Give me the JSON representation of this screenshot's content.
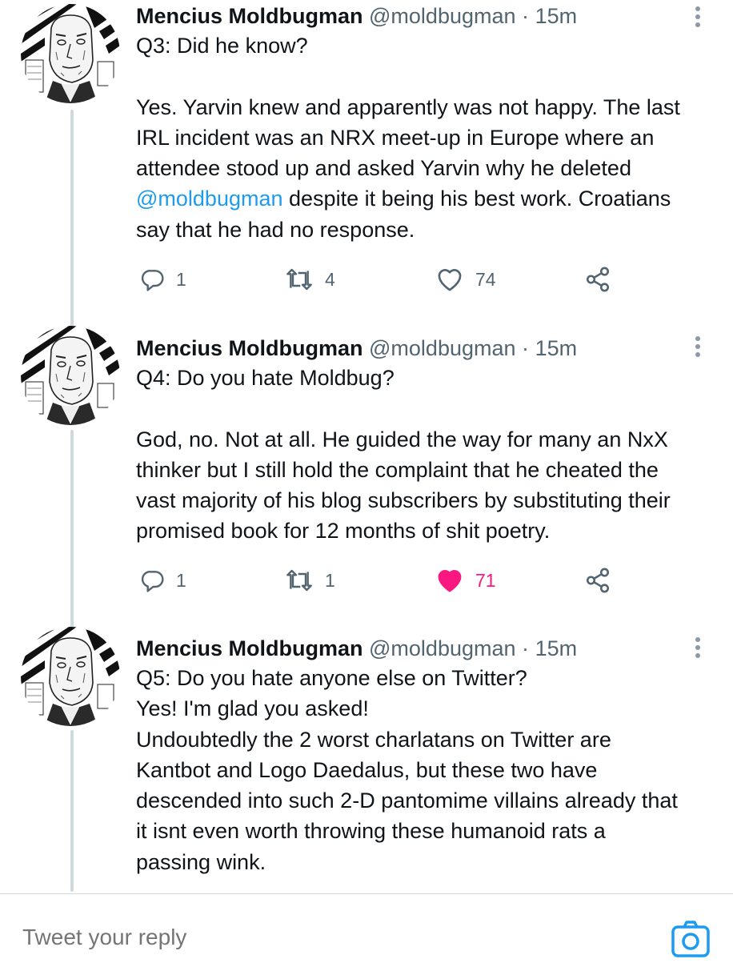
{
  "tweets": [
    {
      "name": "Mencius Moldbugman",
      "handle": "@moldbugman",
      "dot": "·",
      "time": "15m",
      "text_a": "Q3: Did he know?\n\nYes. Yarvin knew and apparently was not happy. The last\nIRL incident was an NRX meet-up in Europe where an\nattendee stood up and asked Yarvin why he deleted\n",
      "mention": "@moldbugman",
      "text_b": " despite it being his best work. Croatians\nsay that he had no response.",
      "replies": "1",
      "retweets": "4",
      "likes": "74",
      "liked": false
    },
    {
      "name": "Mencius Moldbugman",
      "handle": "@moldbugman",
      "dot": "·",
      "time": "15m",
      "text": "Q4: Do you hate Moldbug?\n\nGod, no. Not at all. He guided the way for many an NxX\nthinker but I still hold the complaint that he cheated the\nvast majority of his blog subscribers by substituting their\npromised book for 12 months of shit poetry.",
      "replies": "1",
      "retweets": "1",
      "likes": "71",
      "liked": true
    },
    {
      "name": "Mencius Moldbugman",
      "handle": "@moldbugman",
      "dot": "·",
      "time": "15m",
      "text": "Q5: Do you hate anyone else on Twitter?\nYes! I'm glad you asked!\nUndoubtedly the 2 worst charlatans on Twitter are\nKantbot and Logo Daedalus, but these two have\ndescended into such 2-D pantomime villains already that\nit isnt even worth throwing these humanoid rats a\npassing wink."
    }
  ],
  "composer": {
    "placeholder": "Tweet your reply"
  },
  "colors": {
    "accent": "#1d9bf0",
    "like": "#f91880",
    "muted": "#536471"
  },
  "icons": [
    "reply-icon",
    "retweet-icon",
    "heart-icon",
    "share-icon",
    "more-icon",
    "camera-icon"
  ]
}
